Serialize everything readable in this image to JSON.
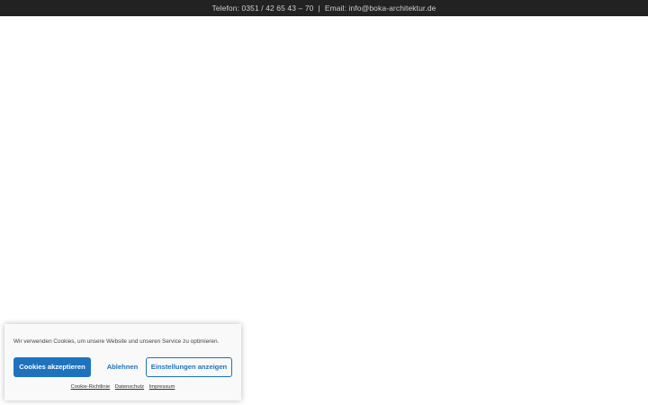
{
  "topbar": {
    "phone": "Telefon: 0351 / 42 65 43 – 70",
    "separator": "|",
    "email": "Email: info@boka-architektur.de"
  },
  "cookie_banner": {
    "message": "Wir verwenden Cookies, um unsere Website und unseren Service zu optimieren.",
    "accept_label": "Cookies akzeptieren",
    "deny_label": "Ablehnen",
    "settings_label": "Einstellungen anzeigen",
    "links": [
      "Cookie-Richtlinie",
      "Datenschutz",
      "Impressum"
    ]
  },
  "colors": {
    "topbar_bg": "#222222",
    "accent": "#1e73be",
    "banner_bg": "#f9f9f9"
  }
}
